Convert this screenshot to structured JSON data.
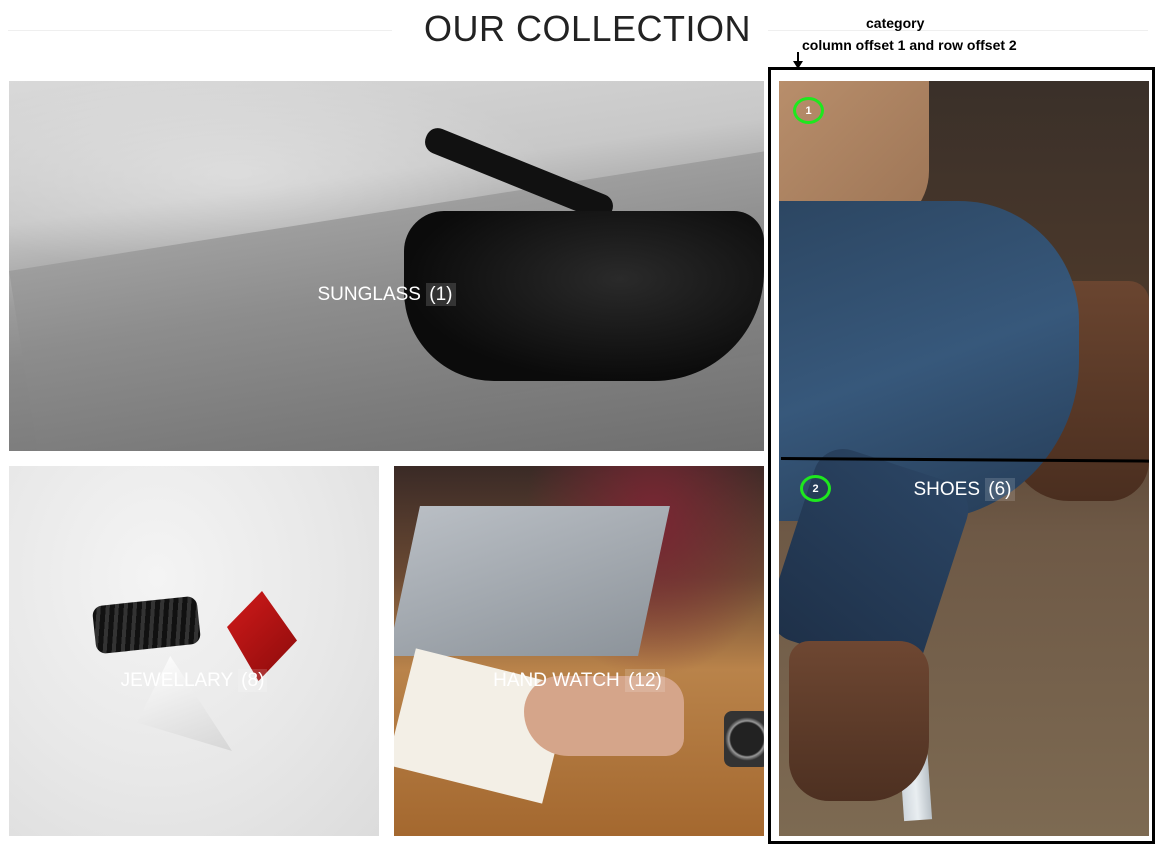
{
  "page": {
    "title": "OUR COLLECTION"
  },
  "categories": [
    {
      "name": "SUNGLASS",
      "count": "(1)"
    },
    {
      "name": "JEWELLARY",
      "count": "(8)"
    },
    {
      "name": "HAND WATCH",
      "count": "(12)"
    },
    {
      "name": "SHOES",
      "count": "(6)"
    }
  ],
  "annotation": {
    "title": "category",
    "subtitle": "column offset 1 and row offset 2",
    "markers": [
      "1",
      "2"
    ],
    "accent_color": "#1ee81e"
  }
}
